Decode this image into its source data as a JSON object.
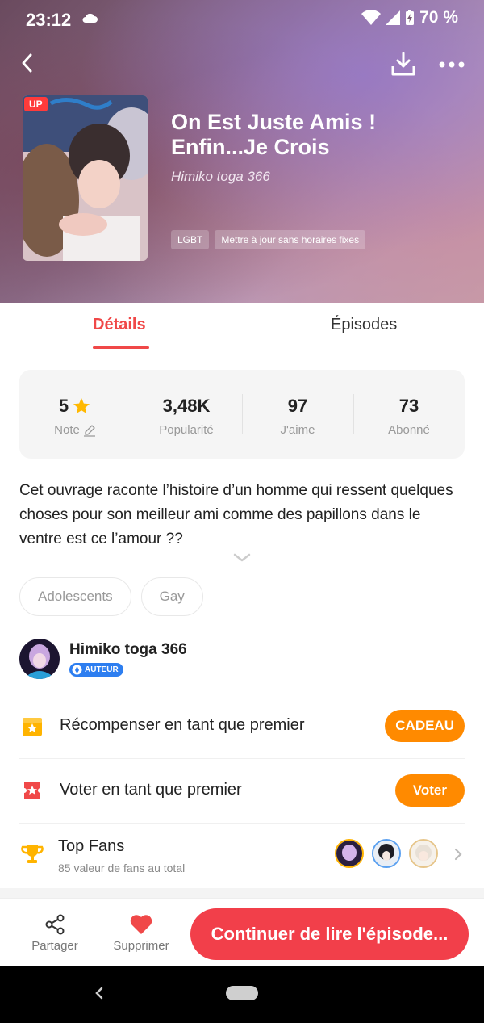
{
  "status_bar": {
    "time": "23:12",
    "battery": "70 %"
  },
  "book": {
    "up_badge": "UP",
    "title": "On Est Juste Amis ! Enfin...Je Crois",
    "author": "Himiko toga 366",
    "tags": [
      "LGBT",
      "Mettre à jour sans horaires fixes"
    ]
  },
  "tabs": {
    "details": "Détails",
    "episodes": "Épisodes"
  },
  "stats": [
    {
      "value": "5",
      "label": "Note"
    },
    {
      "value": "3,48K",
      "label": "Popularité"
    },
    {
      "value": "97",
      "label": "J'aime"
    },
    {
      "value": "73",
      "label": "Abonné"
    }
  ],
  "description": "Cet ouvrage raconte l’histoire d’un homme qui ressent quelques choses pour son meilleur ami comme des papillons dans le ventre est ce l’amour ??",
  "genres": [
    "Adolescents",
    "Gay"
  ],
  "author_section": {
    "name": "Himiko toga 366",
    "badge": "AUTEUR"
  },
  "actions": {
    "reward": {
      "label": "Récompenser en tant que premier",
      "button": "CADEAU"
    },
    "vote": {
      "label": "Voter en tant que premier",
      "button": "Voter"
    }
  },
  "top_fans": {
    "title": "Top Fans",
    "subtitle": "85 valeur de fans au total"
  },
  "bottom_bar": {
    "share": "Partager",
    "delete": "Supprimer",
    "continue": "Continuer de lire l'épisode..."
  },
  "colors": {
    "accent": "#f04848",
    "orange": "#ff8a00",
    "continue": "#f23f4a"
  }
}
